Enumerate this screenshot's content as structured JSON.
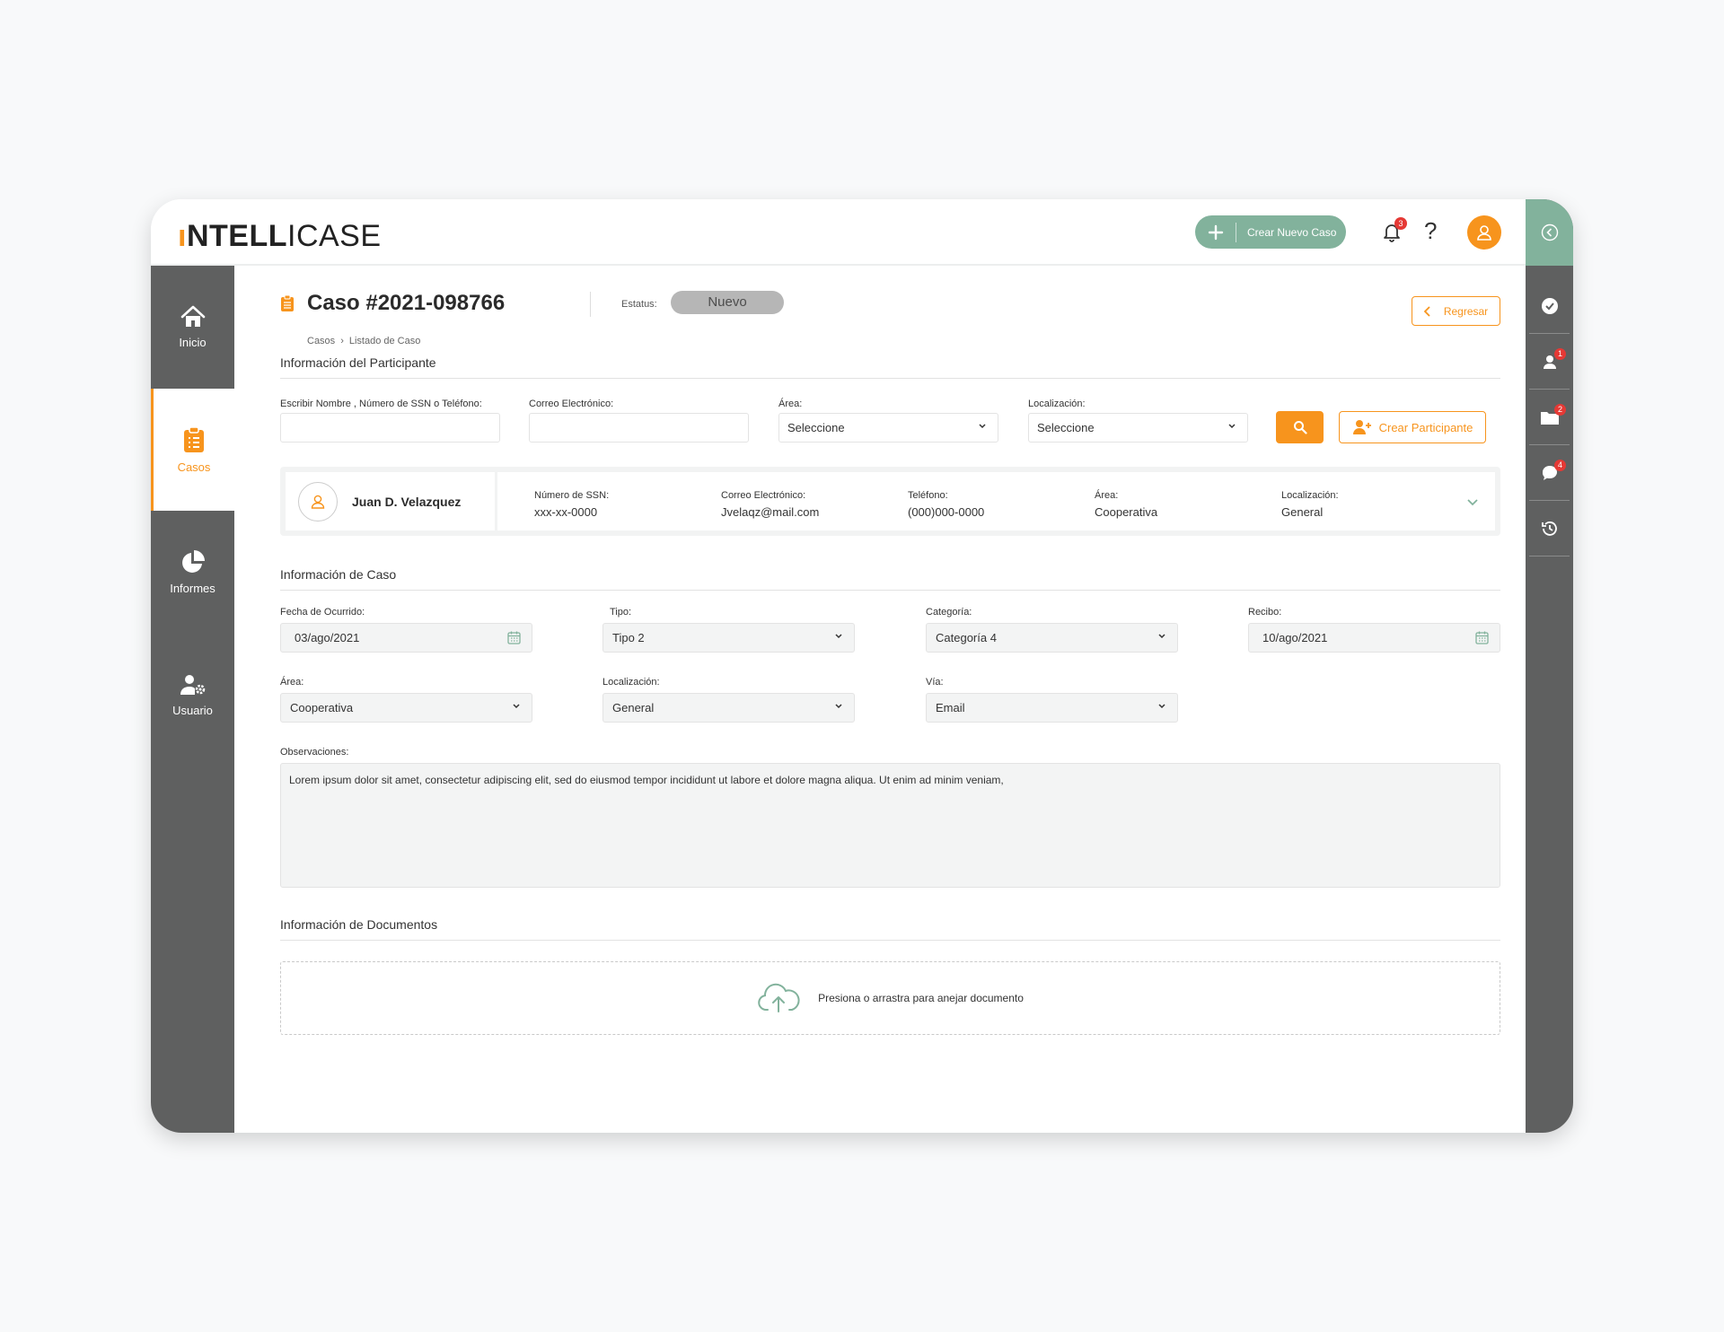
{
  "header": {
    "logo_accent": "ı",
    "logo_bold": "NTELL",
    "logo_light": "ICASE",
    "new_case_label": "Crear Nuevo Caso",
    "notifications_count": "3",
    "help_symbol": "?"
  },
  "sidebar": {
    "items": [
      {
        "label": "Inicio",
        "icon": "home-icon"
      },
      {
        "label": "Casos",
        "icon": "clipboard-icon"
      },
      {
        "label": "Informes",
        "icon": "pie-chart-icon"
      },
      {
        "label": "Usuario",
        "icon": "user-gear-icon"
      }
    ]
  },
  "rail": {
    "badges": {
      "participants": "1",
      "documents": "2",
      "messages": "4"
    }
  },
  "case": {
    "title": "Caso #2021-098766",
    "breadcrumb": [
      "Casos",
      "Listado de Caso"
    ],
    "status_label": "Estatus:",
    "status_value": "Nuevo",
    "back_label": "Regresar"
  },
  "participant_section": {
    "title": "Información del Participante",
    "search_label": "Escribir Nombre , Número de SSN o Teléfono:",
    "search_value": "",
    "email_label": "Correo Electrónico:",
    "email_value": "",
    "area_label": "Área:",
    "area_value": "Seleccione",
    "location_label": "Localización:",
    "location_value": "Seleccione",
    "create_label": "Crear Participante"
  },
  "participant": {
    "name": "Juan D. Velazquez",
    "fields": [
      {
        "label": "Número de SSN:",
        "value": "xxx-xx-0000"
      },
      {
        "label": "Correo Electrónico:",
        "value": "Jvelaqz@mail.com"
      },
      {
        "label": "Teléfono:",
        "value": "(000)000-0000"
      },
      {
        "label": "Área:",
        "value": "Cooperativa"
      },
      {
        "label": "Localización:",
        "value": "General"
      }
    ]
  },
  "case_section": {
    "title": "Información de Caso",
    "date_label": "Fecha de Ocurrido:",
    "date_value": "03/ago/2021",
    "type_label": "Tipo:",
    "type_value": "Tipo 2",
    "category_label": "Categoría:",
    "category_value": "Categoría 4",
    "received_label": "Recibo:",
    "received_value": "10/ago/2021",
    "area_label": "Área:",
    "area_value": "Cooperativa",
    "location_label": "Localización:",
    "location_value": "General",
    "via_label": "Vía:",
    "via_value": "Email",
    "obs_label": "Observaciones:",
    "obs_value": "Lorem ipsum dolor sit amet, consectetur adipiscing elit, sed do eiusmod tempor incididunt ut labore et dolore magna aliqua. Ut enim ad minim veniam,"
  },
  "documents_section": {
    "title": "Información de Documentos",
    "dropzone_text": "Presiona o arrastra para anejar documento"
  },
  "colors": {
    "accent": "#f7941d",
    "green": "#82b29c",
    "sidebar": "#5f6060",
    "badge": "#e53935"
  }
}
